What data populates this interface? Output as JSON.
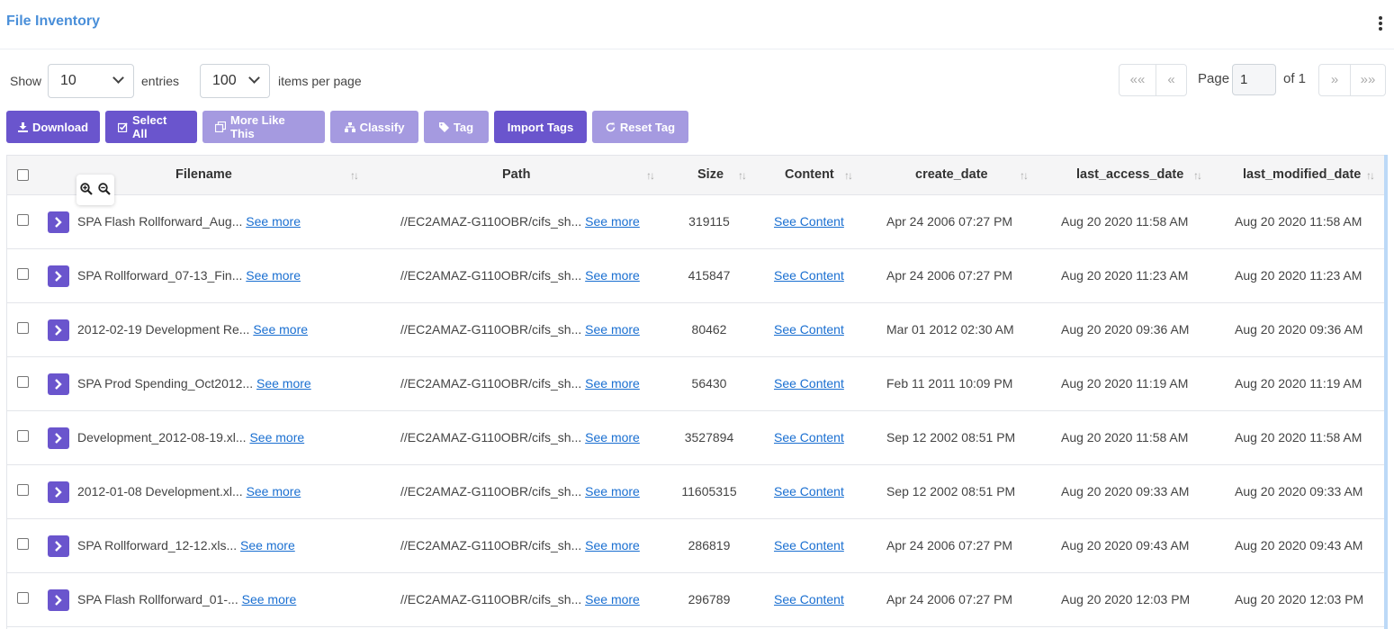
{
  "header": {
    "title": "File Inventory"
  },
  "controls": {
    "show_label": "Show",
    "entries_value": "10",
    "entries_label": "entries",
    "items_value": "100",
    "items_label": "items per page",
    "page_label": "Page",
    "page_value": "1",
    "of_label": "of 1",
    "first": "««",
    "prev": "«",
    "next": "»",
    "last": "»»"
  },
  "toolbar": {
    "download": "Download",
    "select_all": "Select All",
    "more_like_this": "More Like This",
    "classify": "Classify",
    "tag": "Tag",
    "import_tags": "Import Tags",
    "reset_tag": "Reset Tag"
  },
  "colors": {
    "accent": "#6a55cd",
    "accent_dim": "#a59ae0",
    "link": "#1a6fd1",
    "title": "#4a8fd9"
  },
  "table": {
    "columns": [
      "Filename",
      "Path",
      "Size",
      "Content",
      "create_date",
      "last_access_date",
      "last_modified_date"
    ],
    "see_more": "See more",
    "see_content": "See Content",
    "rows": [
      {
        "filename": "SPA Flash Rollforward_Aug...",
        "path": "//EC2AMAZ-G110OBR/cifs_sh...",
        "size": "319115",
        "create_date": "Apr 24 2006 07:27 PM",
        "last_access_date": "Aug 20 2020 11:58 AM",
        "last_modified_date": "Aug 20 2020 11:58 AM"
      },
      {
        "filename": "SPA Rollforward_07-13_Fin...",
        "path": "//EC2AMAZ-G110OBR/cifs_sh...",
        "size": "415847",
        "create_date": "Apr 24 2006 07:27 PM",
        "last_access_date": "Aug 20 2020 11:23 AM",
        "last_modified_date": "Aug 20 2020 11:23 AM"
      },
      {
        "filename": "2012-02-19 Development Re...",
        "path": "//EC2AMAZ-G110OBR/cifs_sh...",
        "size": "80462",
        "create_date": "Mar 01 2012 02:30 AM",
        "last_access_date": "Aug 20 2020 09:36 AM",
        "last_modified_date": "Aug 20 2020 09:36 AM"
      },
      {
        "filename": "SPA Prod Spending_Oct2012...",
        "path": "//EC2AMAZ-G110OBR/cifs_sh...",
        "size": "56430",
        "create_date": "Feb 11 2011 10:09 PM",
        "last_access_date": "Aug 20 2020 11:19 AM",
        "last_modified_date": "Aug 20 2020 11:19 AM"
      },
      {
        "filename": "Development_2012-08-19.xl...",
        "path": "//EC2AMAZ-G110OBR/cifs_sh...",
        "size": "3527894",
        "create_date": "Sep 12 2002 08:51 PM",
        "last_access_date": "Aug 20 2020 11:58 AM",
        "last_modified_date": "Aug 20 2020 11:58 AM"
      },
      {
        "filename": "2012-01-08 Development.xl...",
        "path": "//EC2AMAZ-G110OBR/cifs_sh...",
        "size": "11605315",
        "create_date": "Sep 12 2002 08:51 PM",
        "last_access_date": "Aug 20 2020 09:33 AM",
        "last_modified_date": "Aug 20 2020 09:33 AM"
      },
      {
        "filename": "SPA Rollforward_12-12.xls...",
        "path": "//EC2AMAZ-G110OBR/cifs_sh...",
        "size": "286819",
        "create_date": "Apr 24 2006 07:27 PM",
        "last_access_date": "Aug 20 2020 09:43 AM",
        "last_modified_date": "Aug 20 2020 09:43 AM"
      },
      {
        "filename": "SPA Flash Rollforward_01-...",
        "path": "//EC2AMAZ-G110OBR/cifs_sh...",
        "size": "296789",
        "create_date": "Apr 24 2006 07:27 PM",
        "last_access_date": "Aug 20 2020 12:03 PM",
        "last_modified_date": "Aug 20 2020 12:03 PM"
      }
    ]
  }
}
